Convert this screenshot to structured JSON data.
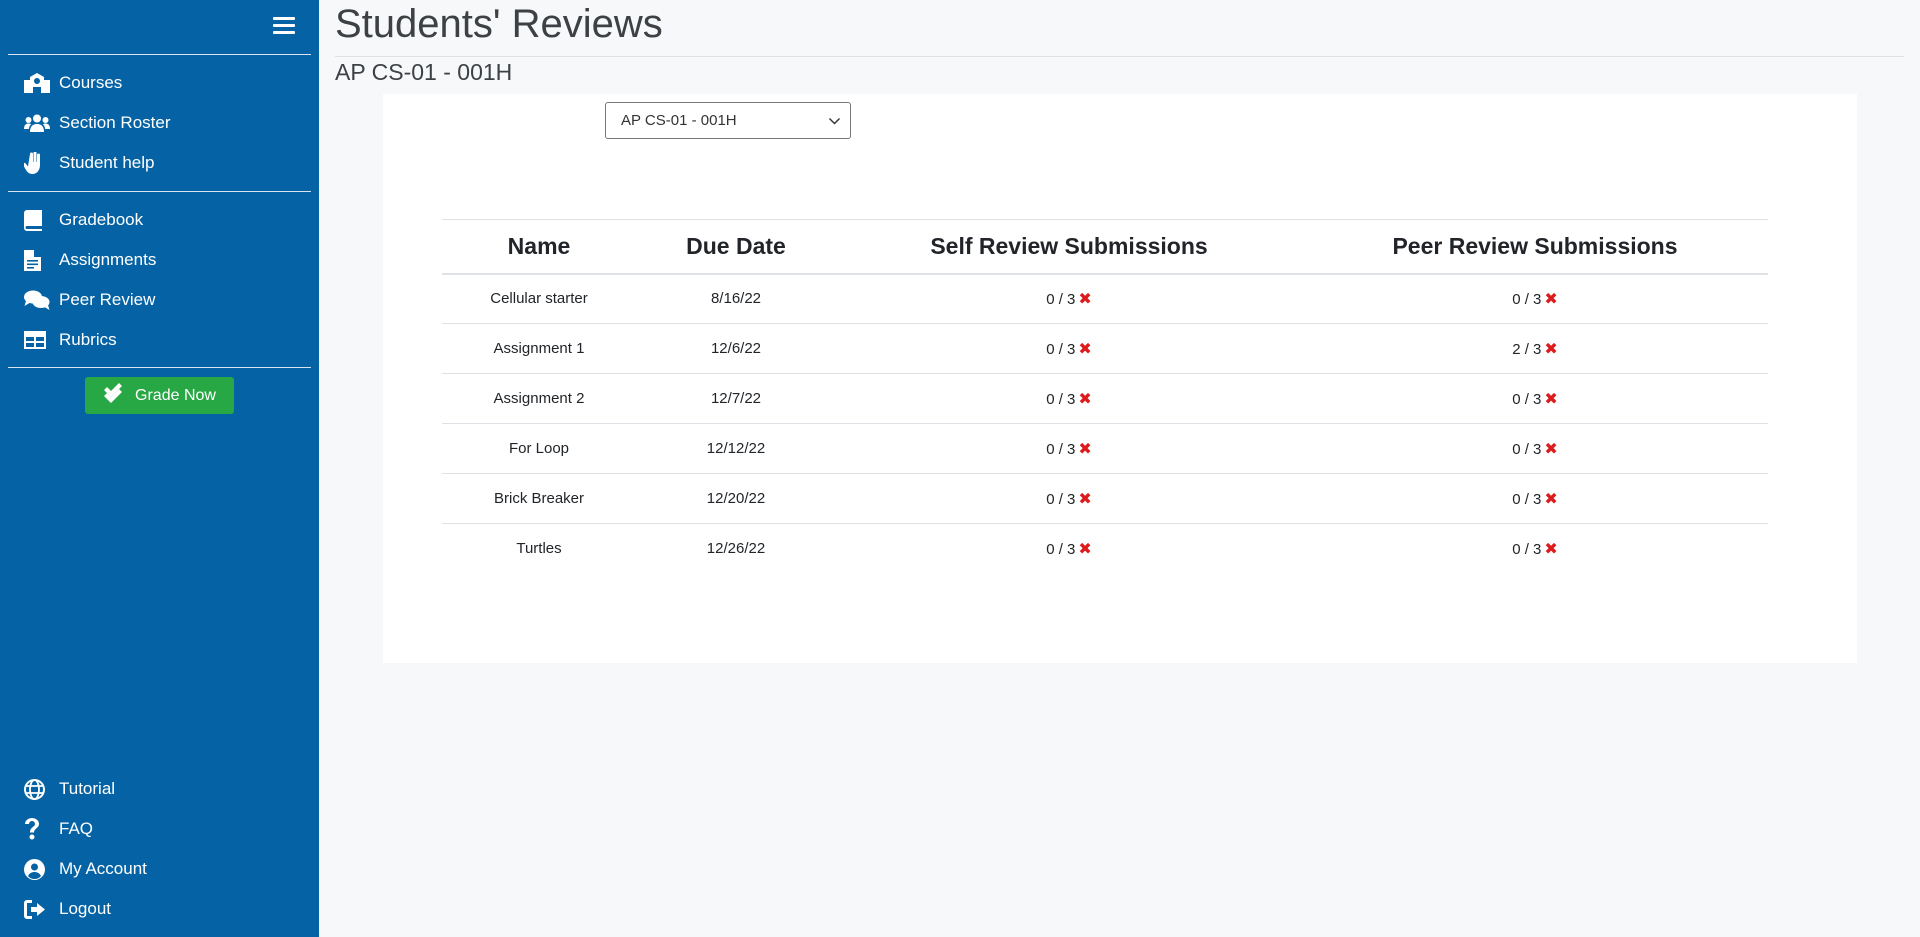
{
  "page": {
    "title": "Students' Reviews",
    "subtitle": "AP CS-01 - 001H"
  },
  "sidebar": {
    "menu_icon": "hamburger-menu-icon",
    "top_items": [
      {
        "label": "Courses",
        "icon": "school-icon"
      },
      {
        "label": "Section Roster",
        "icon": "users-icon"
      },
      {
        "label": "Student help",
        "icon": "raised-hand-icon"
      }
    ],
    "middle_items": [
      {
        "label": "Gradebook",
        "icon": "book-icon"
      },
      {
        "label": "Assignments",
        "icon": "document-icon"
      },
      {
        "label": "Peer Review",
        "icon": "comments-icon"
      },
      {
        "label": "Rubrics",
        "icon": "table-icon"
      }
    ],
    "grade_button": {
      "label": "Grade Now",
      "icon": "double-check-icon",
      "color": "#28a745"
    },
    "bottom_items": [
      {
        "label": "Tutorial",
        "icon": "globe-icon"
      },
      {
        "label": "FAQ",
        "icon": "question-icon"
      },
      {
        "label": "My Account",
        "icon": "user-circle-icon"
      },
      {
        "label": "Logout",
        "icon": "sign-out-icon"
      }
    ],
    "background_color": "#0563a5"
  },
  "section_select": {
    "selected": "AP CS-01 - 001H"
  },
  "table": {
    "headers": [
      "Name",
      "Due Date",
      "Self Review Submissions",
      "Peer Review Submissions"
    ],
    "rows": [
      {
        "name": "Cellular starter",
        "due": "8/16/22",
        "self": "0 / 3",
        "peer": "0 / 3"
      },
      {
        "name": "Assignment 1",
        "due": "12/6/22",
        "self": "0 / 3",
        "peer": "2 / 3"
      },
      {
        "name": "Assignment 2",
        "due": "12/7/22",
        "self": "0 / 3",
        "peer": "0 / 3"
      },
      {
        "name": "For Loop",
        "due": "12/12/22",
        "self": "0 / 3",
        "peer": "0 / 3"
      },
      {
        "name": "Brick Breaker",
        "due": "12/20/22",
        "self": "0 / 3",
        "peer": "0 / 3"
      },
      {
        "name": "Turtles",
        "due": "12/26/22",
        "self": "0 / 3",
        "peer": "0 / 3"
      }
    ],
    "status_icon": "x-mark-icon",
    "status_color": "#dc1c1c"
  }
}
